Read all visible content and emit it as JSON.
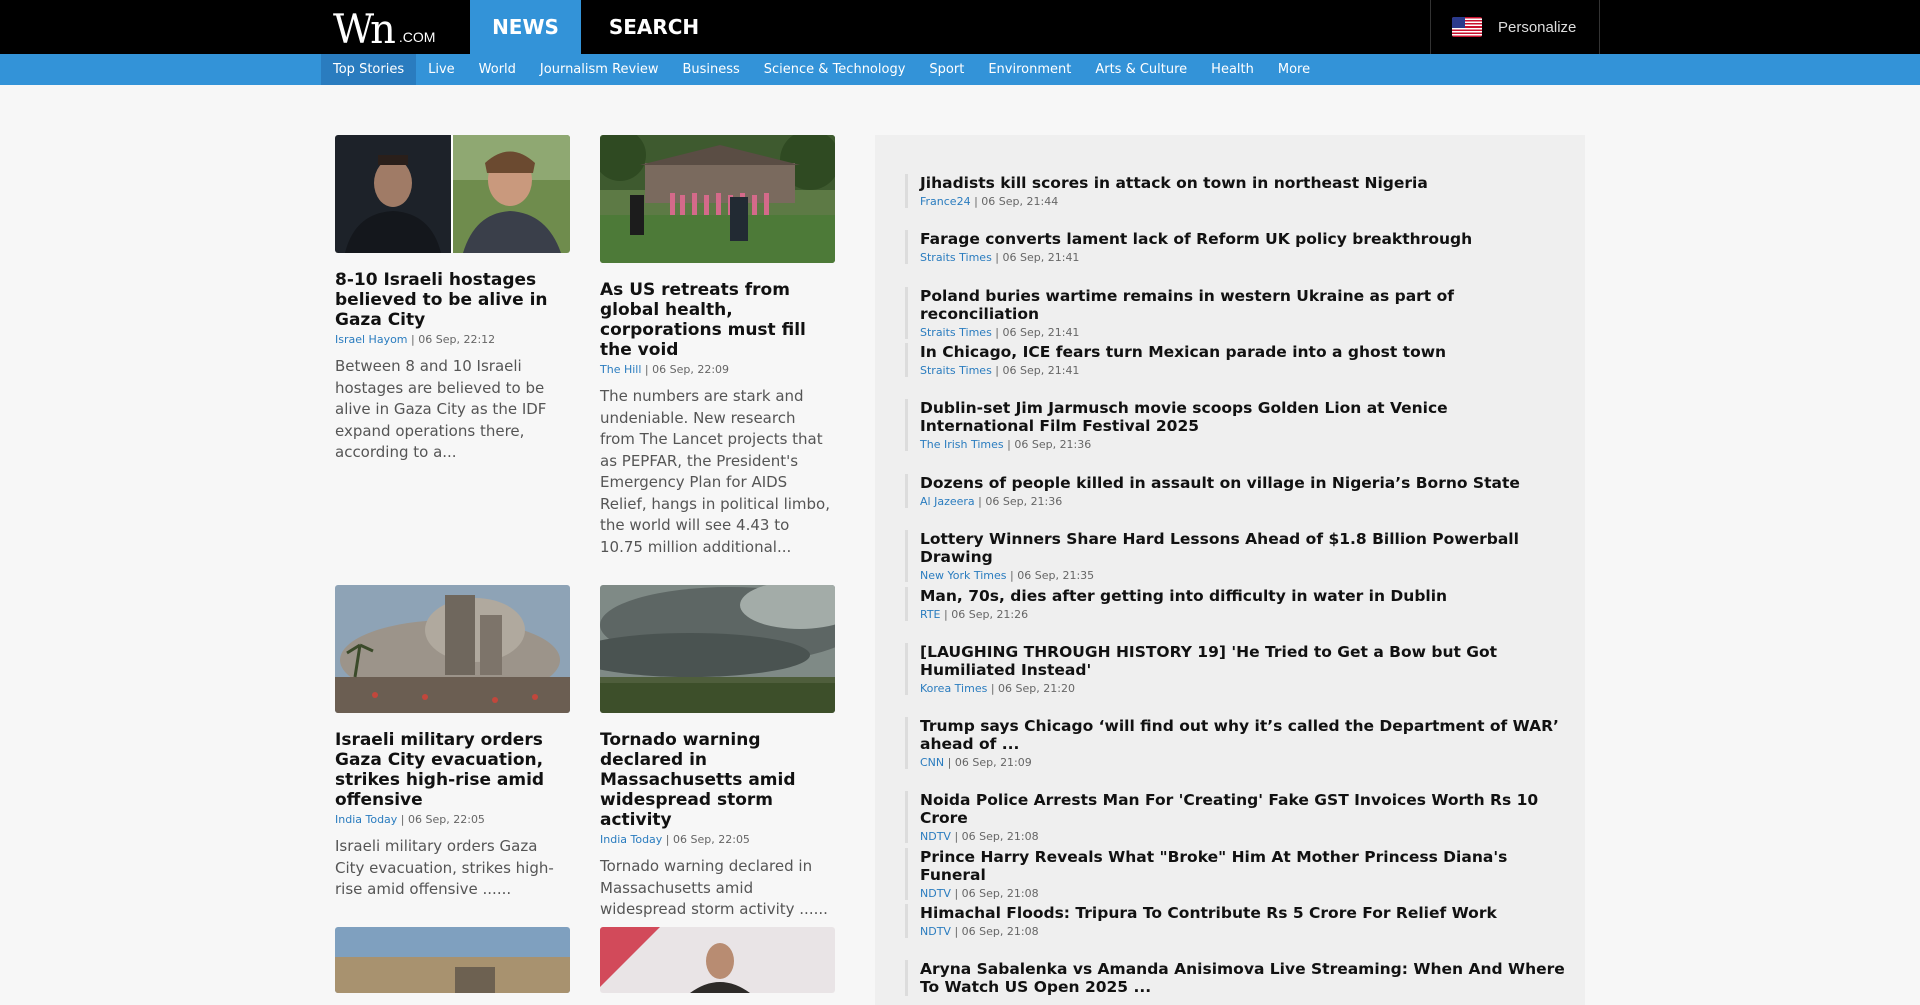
{
  "header": {
    "logo_main": "W",
    "logo_n": "n",
    "logo_suffix": ".COM",
    "news_label": "NEWS",
    "search_label": "SEARCH",
    "personalize_label": "Personalize"
  },
  "categories": [
    "Top Stories",
    "Live",
    "World",
    "Journalism Review",
    "Business",
    "Science & Technology",
    "Sport",
    "Environment",
    "Arts & Culture",
    "Health",
    "More"
  ],
  "articles": [
    {
      "title": "8-10 Israeli hostages believed to be alive in Gaza City",
      "source": "Israel Hayom",
      "time": "06 Sep, 22:12",
      "summary": "Between 8 and 10 Israeli hostages are believed to be alive in Gaza City as the IDF expand operations there, according to a..."
    },
    {
      "title": "As US retreats from global health, corporations must fill the void",
      "source": "The Hill",
      "time": "06 Sep, 22:09",
      "summary": "The numbers are stark and undeniable. New research from The Lancet projects that as PEPFAR, the President's Emergency Plan for AIDS Relief, hangs in political limbo, the world will see 4.43 to 10.75 million additional..."
    },
    {
      "title": "Israeli military orders Gaza City evacuation, strikes high-rise amid offensive",
      "source": "India Today",
      "time": "06 Sep, 22:05",
      "summary": "Israeli military orders Gaza City evacuation, strikes high-rise amid offensive ......"
    },
    {
      "title": "Tornado warning declared in Massachusetts amid widespread storm activity",
      "source": "India Today",
      "time": "06 Sep, 22:05",
      "summary": "Tornado warning declared in Massachusetts amid widespread storm activity ......"
    }
  ],
  "headlines": [
    {
      "title": "Jihadists kill scores in attack on town in northeast Nigeria",
      "source": "France24",
      "time": "06 Sep, 21:44"
    },
    {
      "title": "Farage converts lament lack of Reform UK policy breakthrough",
      "source": "Straits Times",
      "time": "06 Sep, 21:41"
    },
    {
      "title": "Poland buries wartime remains in western Ukraine as part of reconciliation",
      "source": "Straits Times",
      "time": "06 Sep, 21:41"
    },
    {
      "title": "In Chicago, ICE fears turn Mexican parade into a ghost town",
      "source": "Straits Times",
      "time": "06 Sep, 21:41"
    },
    {
      "title": "Dublin-set Jim Jarmusch movie scoops Golden Lion at Venice International Film Festival 2025",
      "source": "The Irish Times",
      "time": "06 Sep, 21:36"
    },
    {
      "title": "Dozens of people killed in assault on village in Nigeria’s Borno State",
      "source": "Al Jazeera",
      "time": "06 Sep, 21:36"
    },
    {
      "title": "Lottery Winners Share Hard Lessons Ahead of $1.8 Billion Powerball Drawing",
      "source": "New York Times",
      "time": "06 Sep, 21:35"
    },
    {
      "title": "Man, 70s, dies after getting into difficulty in water in Dublin",
      "source": "RTE",
      "time": "06 Sep, 21:26"
    },
    {
      "title": "[LAUGHING THROUGH HISTORY 19] 'He Tried to Get a Bow but Got Humiliated Instead'",
      "source": "Korea Times",
      "time": "06 Sep, 21:20"
    },
    {
      "title": "Trump says Chicago ‘will find out why it’s called the Department of WAR’ ahead of ...",
      "source": "CNN",
      "time": "06 Sep, 21:09"
    },
    {
      "title": "Noida Police Arrests Man For 'Creating' Fake GST Invoices Worth Rs 10 Crore",
      "source": "NDTV",
      "time": "06 Sep, 21:08"
    },
    {
      "title": "Prince Harry Reveals What \"Broke\" Him At Mother Princess Diana's Funeral",
      "source": "NDTV",
      "time": "06 Sep, 21:08"
    },
    {
      "title": "Himachal Floods: Tripura To Contribute Rs 5 Crore For Relief Work",
      "source": "NDTV",
      "time": "06 Sep, 21:08"
    },
    {
      "title": "Aryna Sabalenka vs Amanda Anisimova Live Streaming: When And Where To Watch US Open 2025 ...",
      "source": "",
      "time": ""
    }
  ],
  "separator": " | "
}
